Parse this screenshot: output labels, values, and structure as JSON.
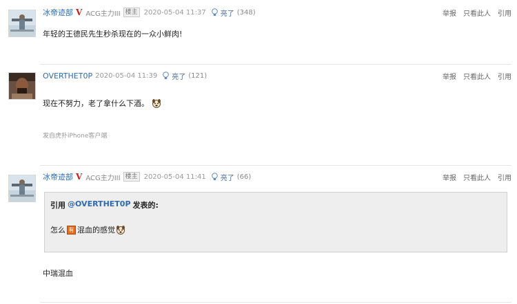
{
  "actions": {
    "report": "举报",
    "only_this": "只看此人",
    "quote": "引用"
  },
  "posts": [
    {
      "username": "冰帝迹部",
      "vip_badge": "V",
      "rank": "ACG主力III",
      "op_tag": "楼主",
      "time": "2020-05-04 11:37",
      "light_label": "亮了",
      "light_count": "(348)",
      "content": "年轻的王德民先生秒杀现在的一众小鲜肉!"
    },
    {
      "username": "OVERTHET0P",
      "time": "2020-05-04 11:39",
      "light_label": "亮了",
      "light_count": "(121)",
      "content": "现在不努力，老了拿什么下酒。",
      "emoji": "doge-icon",
      "source": "发自虎扑iPhone客户端"
    },
    {
      "username": "冰帝迹部",
      "vip_badge": "V",
      "rank": "ACG主力III",
      "op_tag": "楼主",
      "time": "2020-05-04 11:41",
      "light_label": "亮了",
      "light_count": "(66)",
      "quote": {
        "prefix": "引用",
        "name": "@OVERTHET0P",
        "suffix": "发表的:",
        "body_before": "怎么",
        "tag_text": "有",
        "body_after": "混血的感觉"
      },
      "content": "中瑞混血"
    }
  ],
  "colors": {
    "link": "#2d6ab2",
    "vip": "#c0241f",
    "quote_bg": "#eeeeee",
    "tag": "#e86a1c"
  }
}
